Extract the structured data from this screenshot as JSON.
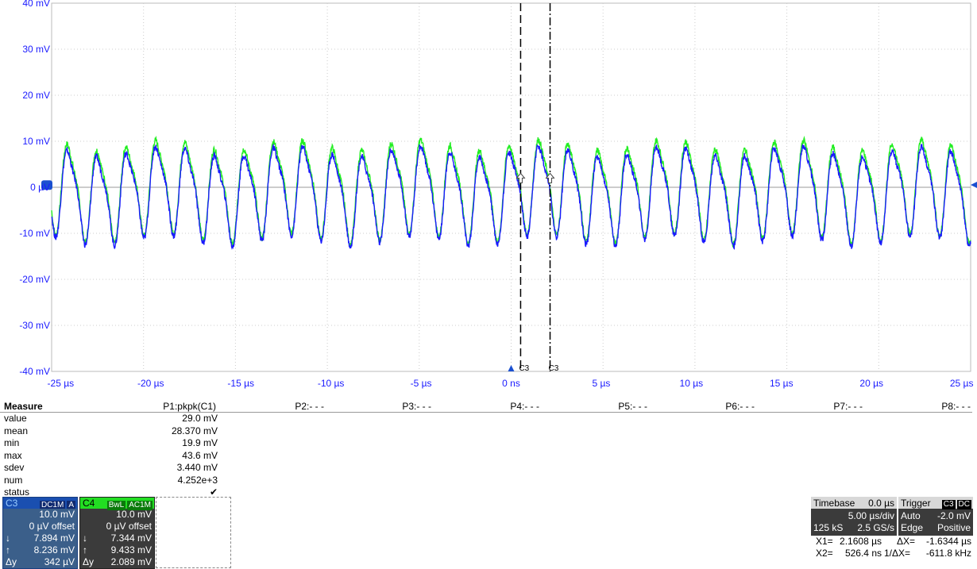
{
  "chart_data": {
    "type": "line",
    "xlabel": "",
    "ylabel": "",
    "x_ticks": [
      "-25 µs",
      "-20 µs",
      "-15 µs",
      "-10 µs",
      "-5 µs",
      "0 ns",
      "5 µs",
      "10 µs",
      "15 µs",
      "20 µs",
      "25 µs"
    ],
    "y_ticks": [
      "40 mV",
      "30 mV",
      "20 mV",
      "10 mV",
      "0 µV",
      "-10 mV",
      "-20 mV",
      "-30 mV",
      "-40 mV"
    ],
    "xlim_us": [
      -25.5,
      25.5
    ],
    "ylim_mv": [
      -40,
      40
    ],
    "grid": true,
    "series": [
      {
        "name": "C3",
        "color": "#1a1aff",
        "amplitude_mv": 10.5,
        "offset_mv": -1.0,
        "period_us": 1.635
      },
      {
        "name": "C4",
        "color": "#22ee22",
        "amplitude_mv": 11.0,
        "offset_mv": 0.0,
        "period_us": 1.635
      }
    ],
    "cursors": [
      {
        "label": "C3",
        "x_us": 0.5264,
        "style": "dash"
      },
      {
        "label": "C3",
        "x_us": 2.1608,
        "style": "dashdot"
      }
    ]
  },
  "measure": {
    "title": "Measure",
    "columns": [
      "P1:pkpk(C1)",
      "P2:- - -",
      "P3:- - -",
      "P4:- - -",
      "P5:- - -",
      "P6:- - -",
      "P7:- - -",
      "P8:- - -"
    ],
    "rows": [
      {
        "k": "value",
        "v": "29.0 mV"
      },
      {
        "k": "mean",
        "v": "28.370 mV"
      },
      {
        "k": "min",
        "v": "19.9 mV"
      },
      {
        "k": "max",
        "v": "43.6 mV"
      },
      {
        "k": "sdev",
        "v": "3.440 mV"
      },
      {
        "k": "num",
        "v": "4.252e+3"
      },
      {
        "k": "status",
        "v": "✔"
      }
    ]
  },
  "c3": {
    "name": "C3",
    "tag1": "DC1M",
    "tag2": "A",
    "scale": "10.0 mV",
    "offset": "0 µV offset",
    "down": "7.894 mV",
    "up": "8.236 mV",
    "dy": "342 µV",
    "dy_label": "Δy",
    "color": "#2a6fbf"
  },
  "c4": {
    "name": "C4",
    "tag1": "BwL",
    "tag2": "AC1M",
    "scale": "10.0 mV",
    "offset": "0 µV offset",
    "down": "7.344 mV",
    "up": "9.433 mV",
    "dy": "2.089 mV",
    "dy_label": "Δy",
    "color": "#22dd22"
  },
  "timebase": {
    "title": "Timebase",
    "delay": "0.0 µs",
    "div": "5.00 µs/div",
    "samples": "125 kS",
    "rate": "2.5 GS/s"
  },
  "trigger": {
    "title": "Trigger",
    "src": "C3",
    "coupling": "DC",
    "mode": "Auto",
    "level": "-2.0 mV",
    "type": "Edge",
    "slope": "Positive"
  },
  "cursor_readout": {
    "x1_label": "X1=",
    "x1": "2.1608 µs",
    "dx_label": "ΔX=",
    "dx": "-1.6344 µs",
    "x2_label": "X2=",
    "x2": "526.4 ns",
    "inv_label": "1/ΔX=",
    "inv": "-611.8 kHz"
  }
}
